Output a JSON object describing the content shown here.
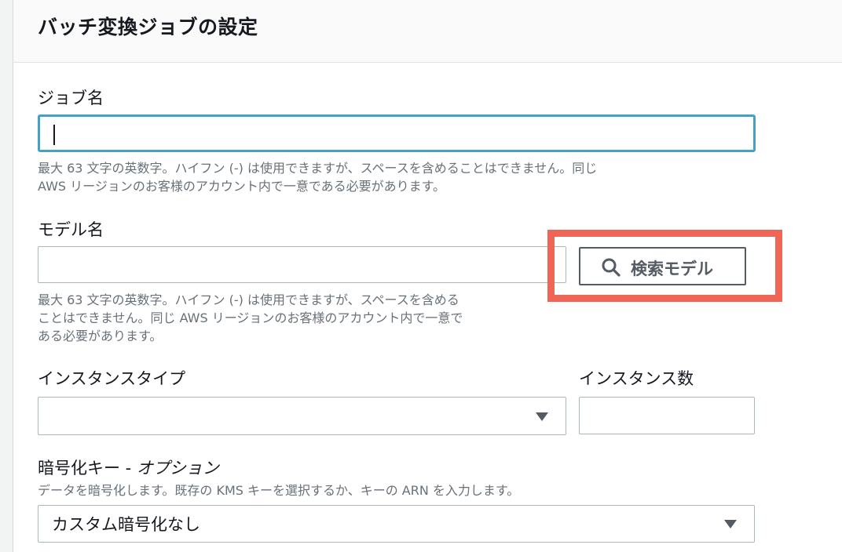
{
  "section": {
    "title": "バッチ変換ジョブの設定"
  },
  "job_name": {
    "label": "ジョブ名",
    "value": "",
    "help_line1": "最大 63 文字の英数字。ハイフン (-) は使用できますが、スペースを含めることはできません。同じ",
    "help_line2": "AWS リージョンのお客様のアカウント内で一意である必要があります。"
  },
  "model_name": {
    "label": "モデル名",
    "value": "",
    "help_line1": "最大 63 文字の英数字。ハイフン (-) は使用できますが、スペースを含める",
    "help_line2": "ことはできません。同じ AWS リージョンのお客様のアカウント内で一意で",
    "help_line3": "ある必要があります。",
    "search_button_label": "検索モデル"
  },
  "instance_type": {
    "label": "インスタンスタイプ",
    "selected": ""
  },
  "instance_count": {
    "label": "インスタンス数",
    "value": ""
  },
  "encryption_key": {
    "label": "暗号化キー - ",
    "label_optional": "オプション",
    "help": "データを暗号化します。既存の KMS キーを選択するか、キーの ARN を入力します。",
    "selected": "カスタム暗号化なし"
  },
  "colors": {
    "highlight": "#ef6556",
    "focus": "#44a1c4"
  }
}
